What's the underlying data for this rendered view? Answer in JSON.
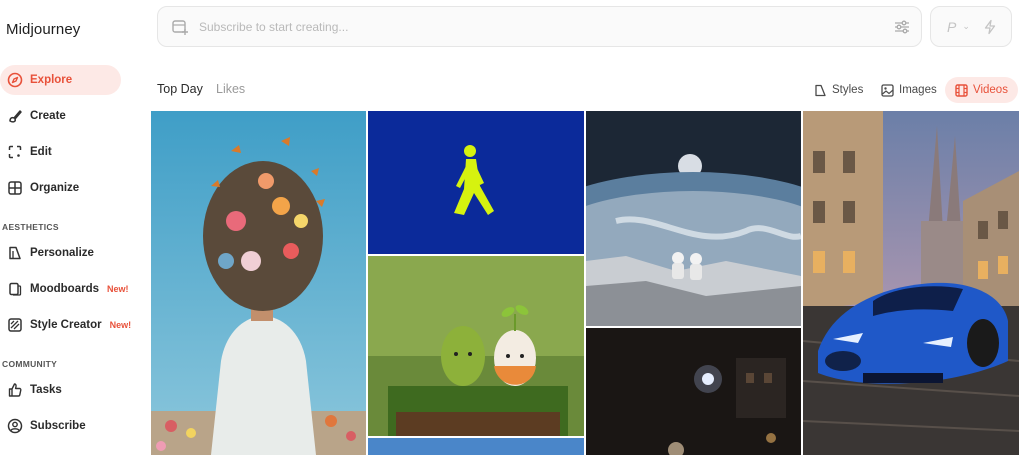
{
  "app": {
    "title": "Midjourney"
  },
  "sidebar": {
    "items": [
      {
        "label": "Explore",
        "icon": "compass-icon",
        "active": true
      },
      {
        "label": "Create",
        "icon": "brush-icon"
      },
      {
        "label": "Edit",
        "icon": "edit-frame-icon"
      },
      {
        "label": "Organize",
        "icon": "grid-icon"
      }
    ],
    "aesthetics_label": "AESTHETICS",
    "aesthetics_items": [
      {
        "label": "Personalize",
        "icon": "personalize-icon"
      },
      {
        "label": "Moodboards",
        "icon": "moodboard-icon",
        "badge": "New!"
      },
      {
        "label": "Style Creator",
        "icon": "style-creator-icon",
        "badge": "New!"
      }
    ],
    "community_label": "COMMUNITY",
    "community_items": [
      {
        "label": "Tasks",
        "icon": "thumbs-up-icon"
      },
      {
        "label": "Subscribe",
        "icon": "user-circle-icon"
      }
    ]
  },
  "search": {
    "placeholder": "Subscribe to start creating..."
  },
  "profile": {
    "initial": "P",
    "chevron": "⌄"
  },
  "tabs": [
    {
      "label": "Top Day"
    },
    {
      "label": "Likes"
    }
  ],
  "views": [
    {
      "label": "Styles",
      "icon": "styles-icon"
    },
    {
      "label": "Images",
      "icon": "image-icon"
    },
    {
      "label": "Videos",
      "icon": "video-icon",
      "active": true
    }
  ],
  "colors": {
    "accent": "#e8513a",
    "accent_bg": "#fde9e6"
  }
}
